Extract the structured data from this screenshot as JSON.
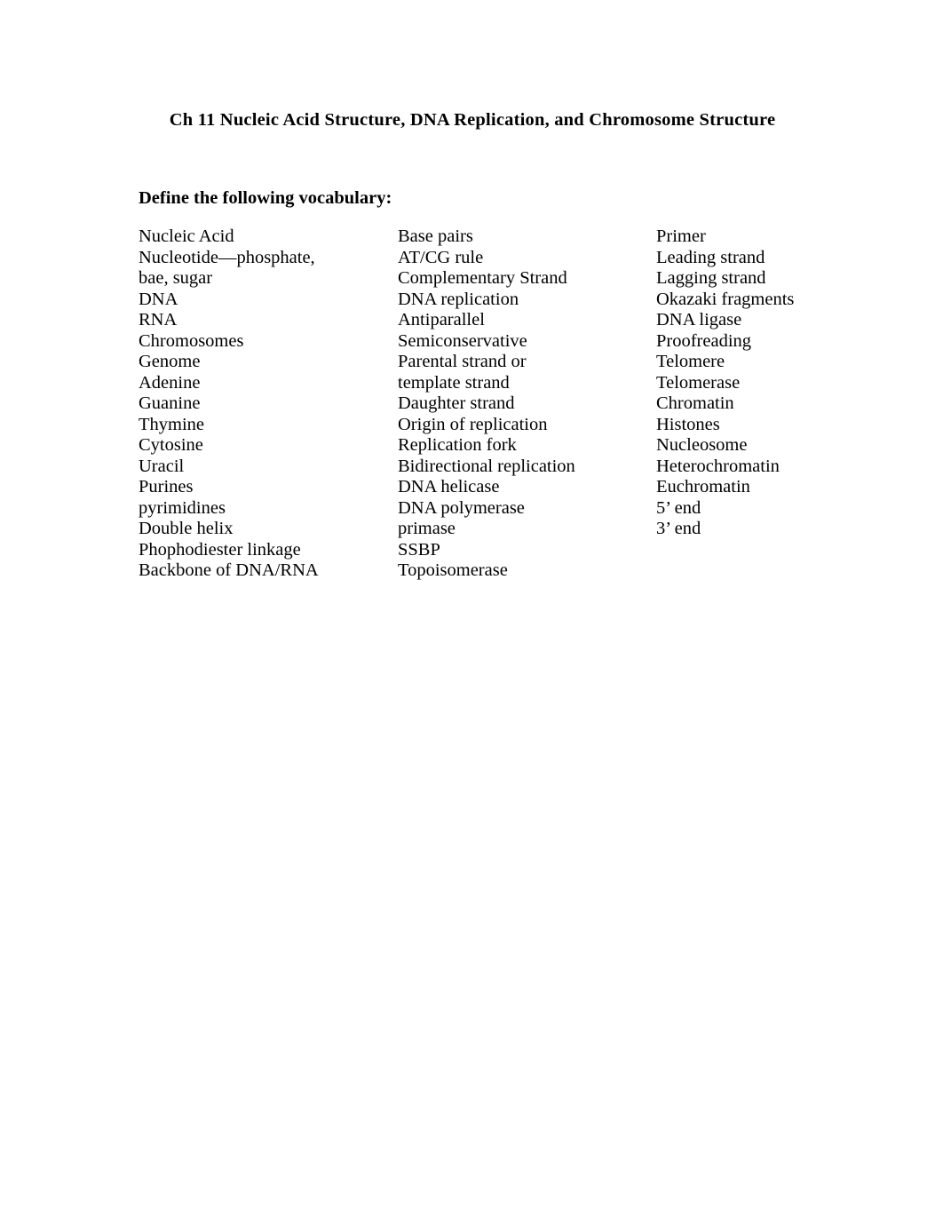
{
  "document": {
    "title": "Ch 11 Nucleic Acid Structure, DNA Replication, and Chromosome Structure",
    "section_heading": "Define the following vocabulary:",
    "vocabulary_columns": [
      {
        "column_name": "vocabulary-column-1",
        "items": [
          "Nucleic Acid",
          "Nucleotide—phosphate,",
          "bae, sugar",
          "DNA",
          "RNA",
          "Chromosomes",
          "Genome",
          "Adenine",
          "Guanine",
          "Thymine",
          "Cytosine",
          "Uracil",
          "Purines",
          "pyrimidines",
          "Double helix",
          "Phophodiester linkage",
          "Backbone of DNA/RNA"
        ]
      },
      {
        "column_name": "vocabulary-column-2",
        "items": [
          "Base pairs",
          "AT/CG rule",
          "Complementary Strand",
          "DNA replication",
          "Antiparallel",
          "Semiconservative",
          "Parental strand or",
          "template strand",
          "Daughter strand",
          "Origin of replication",
          "Replication fork",
          "Bidirectional replication",
          "DNA helicase",
          "DNA polymerase",
          "primase",
          "SSBP",
          "Topoisomerase"
        ]
      },
      {
        "column_name": "vocabulary-column-3",
        "items": [
          "Primer",
          "Leading strand",
          "Lagging strand",
          "Okazaki fragments",
          "DNA ligase",
          "Proofreading",
          "Telomere",
          "Telomerase",
          "Chromatin",
          "Histones",
          "Nucleosome",
          "Heterochromatin",
          "Euchromatin",
          "5’ end",
          "3’ end"
        ]
      }
    ]
  },
  "colors": {
    "page_background": "#ffffff",
    "text": "#000000"
  }
}
